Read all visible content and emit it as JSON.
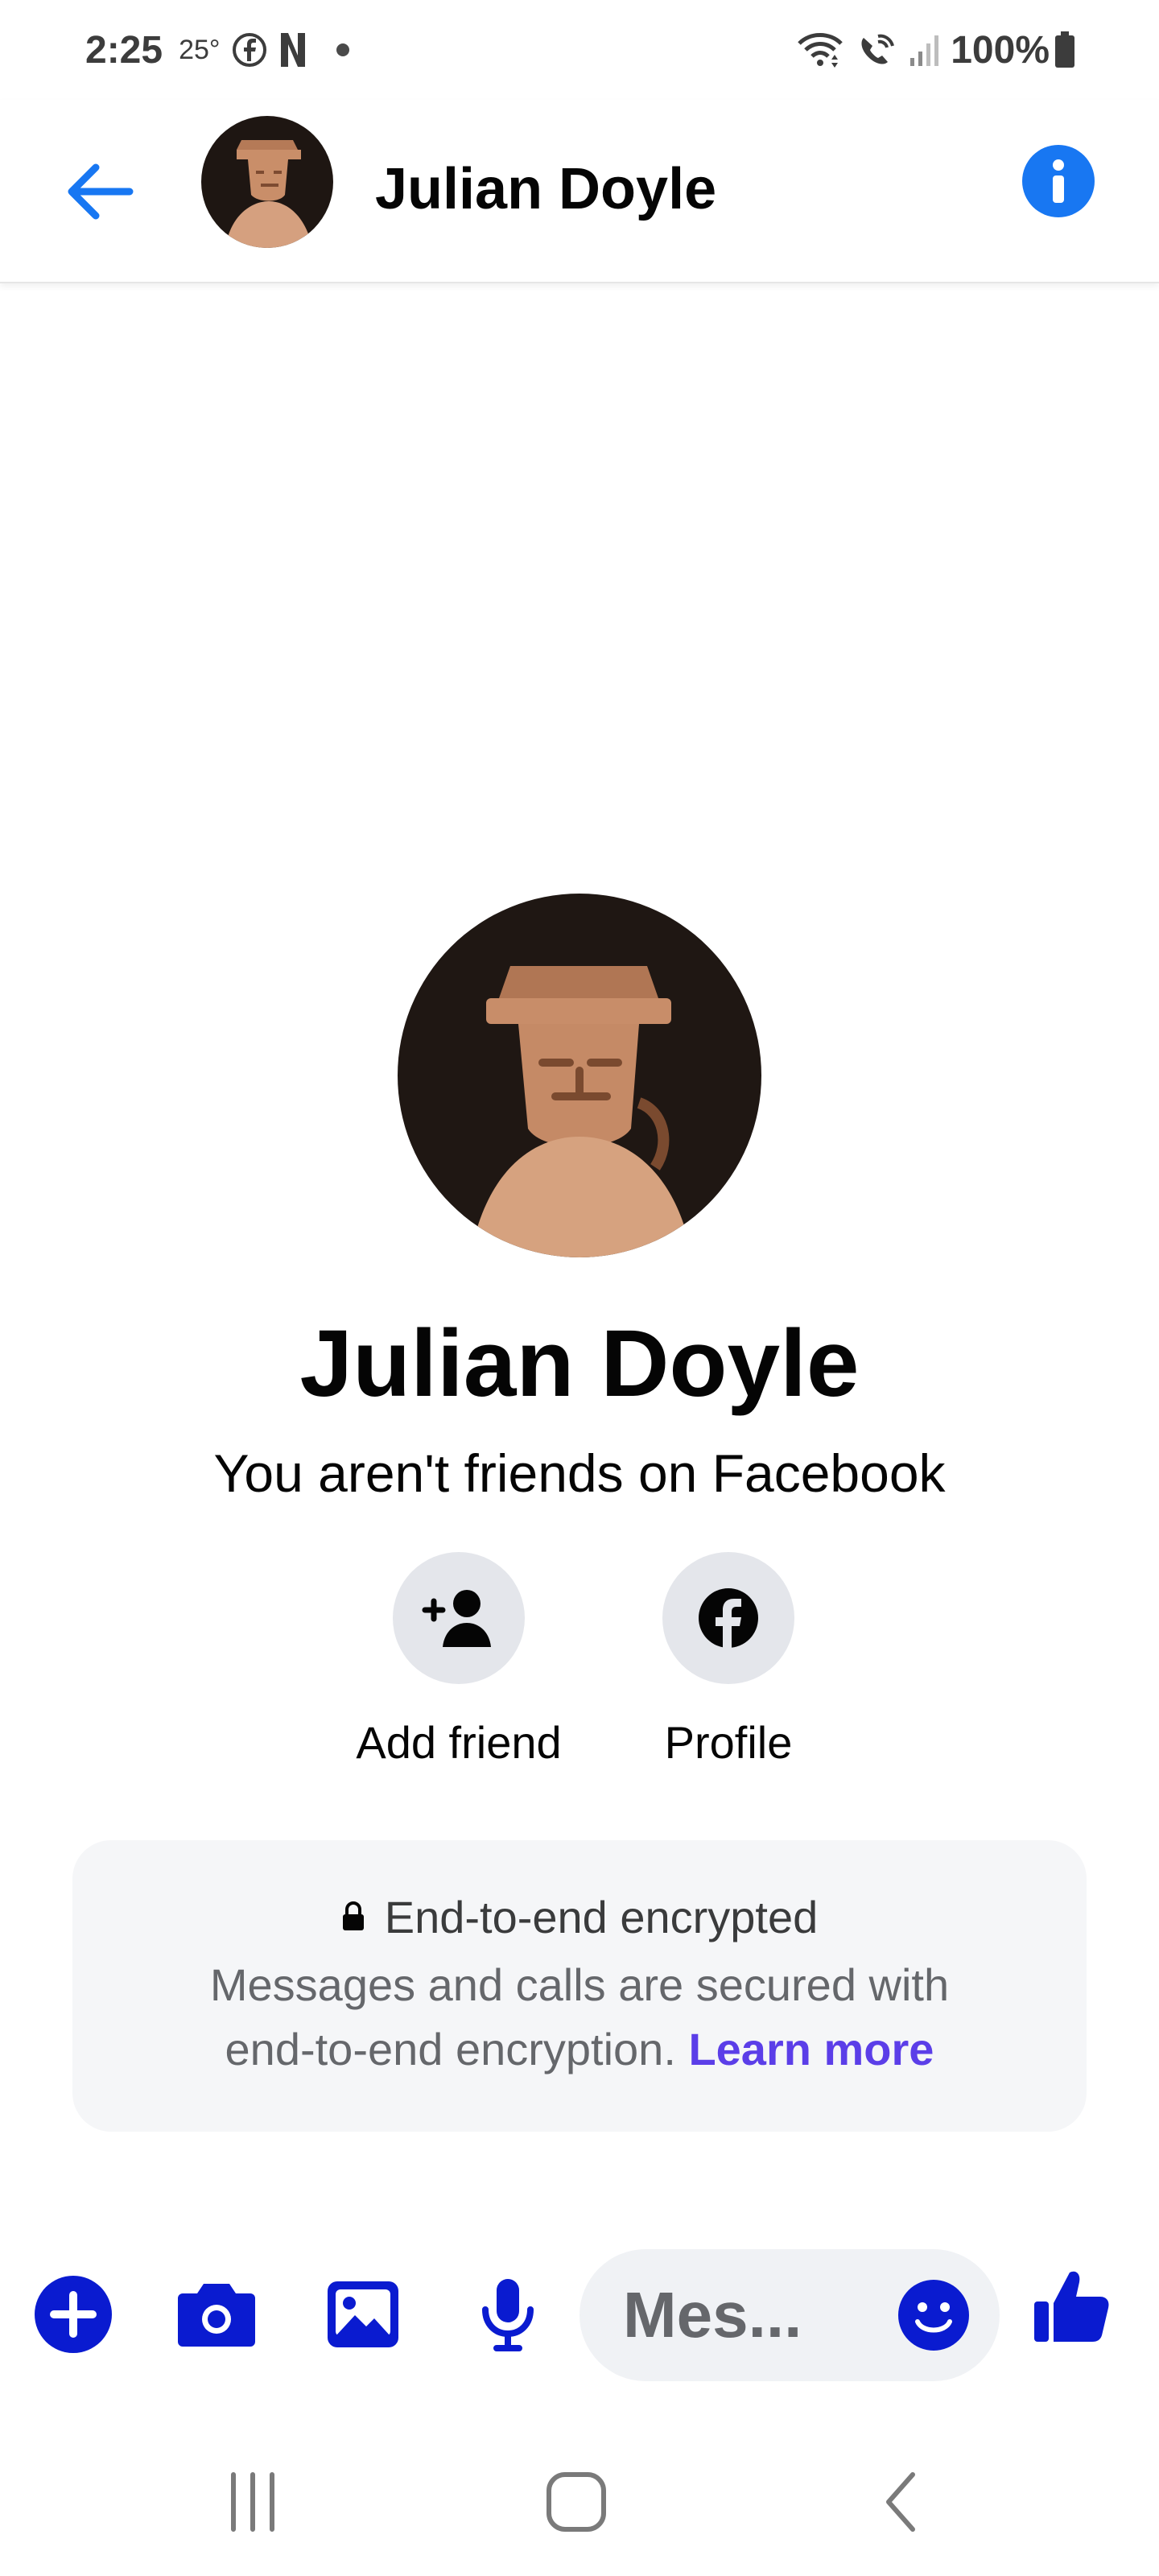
{
  "status_bar": {
    "time": "2:25",
    "temperature": "25°",
    "battery": "100%",
    "icons": [
      "facebook-icon",
      "netflix-icon",
      "dot-icon",
      "wifi-icon",
      "wifi-call-icon",
      "signal-icon",
      "battery-icon"
    ]
  },
  "header": {
    "contact_name": "Julian Doyle",
    "icons": [
      "back-arrow-icon",
      "info-icon"
    ]
  },
  "profile": {
    "name": "Julian Doyle",
    "subtitle": "You aren't friends on Facebook",
    "actions": [
      {
        "label": "Add friend",
        "icon": "add-friend-icon"
      },
      {
        "label": "Profile",
        "icon": "facebook-icon"
      }
    ]
  },
  "encryption": {
    "title": "End-to-end encrypted",
    "body_line1": "Messages and calls are secured with",
    "body_line2": "end-to-end encryption.",
    "link": "Learn more"
  },
  "composer": {
    "placeholder": "Mes...",
    "icons": [
      "plus-icon",
      "camera-icon",
      "gallery-icon",
      "microphone-icon",
      "emoji-icon",
      "thumbs-up-icon"
    ]
  },
  "nav_bar": {
    "icons": [
      "recent-apps-icon",
      "home-icon",
      "back-icon"
    ]
  },
  "colors": {
    "accent_blue": "#1877f2",
    "composer_blue": "#0a1bd0",
    "link_purple": "#5b3ee8",
    "card_bg": "#f5f6f8"
  }
}
